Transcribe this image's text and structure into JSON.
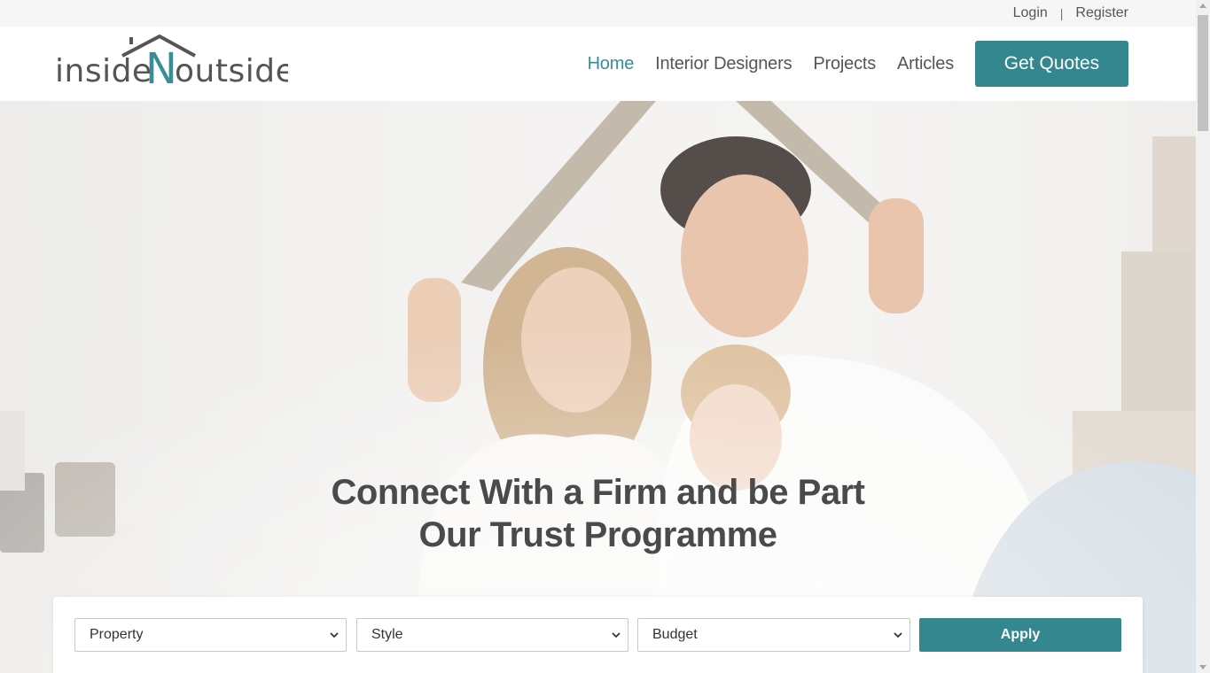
{
  "topbar": {
    "login": "Login",
    "separator": "|",
    "register": "Register"
  },
  "logo": {
    "part1": "inside",
    "part2": "N",
    "part3": "outside"
  },
  "nav": {
    "items": [
      {
        "label": "Home",
        "active": true
      },
      {
        "label": "Interior Designers"
      },
      {
        "label": "Projects"
      },
      {
        "label": "Articles"
      }
    ],
    "cta": "Get Quotes"
  },
  "hero": {
    "title_line1": "Connect With a Firm and be Part",
    "title_line2": "Our Trust Programme"
  },
  "filters": {
    "property": "Property",
    "style": "Style",
    "budget": "Budget",
    "apply": "Apply"
  },
  "colors": {
    "accent": "#34878f",
    "text": "#555555"
  }
}
